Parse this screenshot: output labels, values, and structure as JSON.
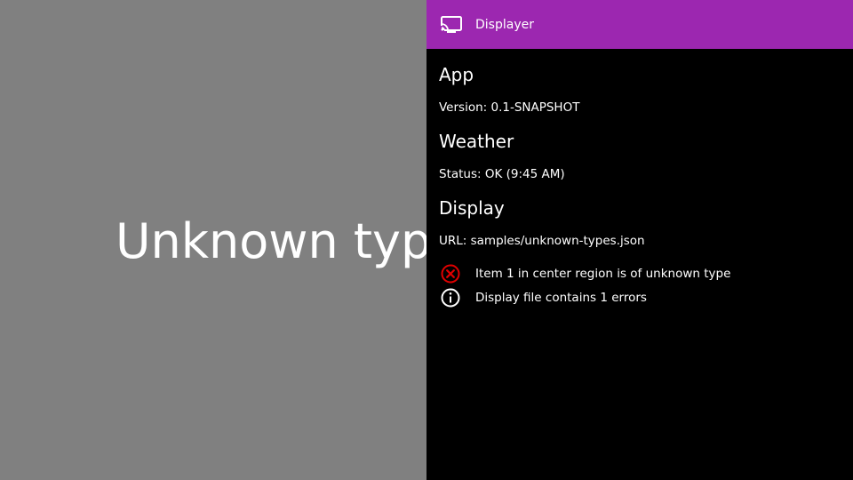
{
  "background": {
    "placeholder_text": "Unknown type",
    "color": "#808080"
  },
  "panel": {
    "header": {
      "title": "Displayer",
      "icon": "cast-icon",
      "color": "#9c27b0"
    },
    "sections": {
      "app": {
        "heading": "App",
        "line": "Version: 0.1-SNAPSHOT"
      },
      "weather": {
        "heading": "Weather",
        "line": "Status: OK (9:45 AM)"
      },
      "display": {
        "heading": "Display",
        "line": "URL: samples/unknown-types.json"
      }
    },
    "messages": [
      {
        "icon": "error-icon",
        "text": "Item 1 in center region is of unknown type",
        "color": "#e00000"
      },
      {
        "icon": "info-icon",
        "text": "Display file contains 1 errors",
        "color": "#ffffff"
      }
    ]
  }
}
